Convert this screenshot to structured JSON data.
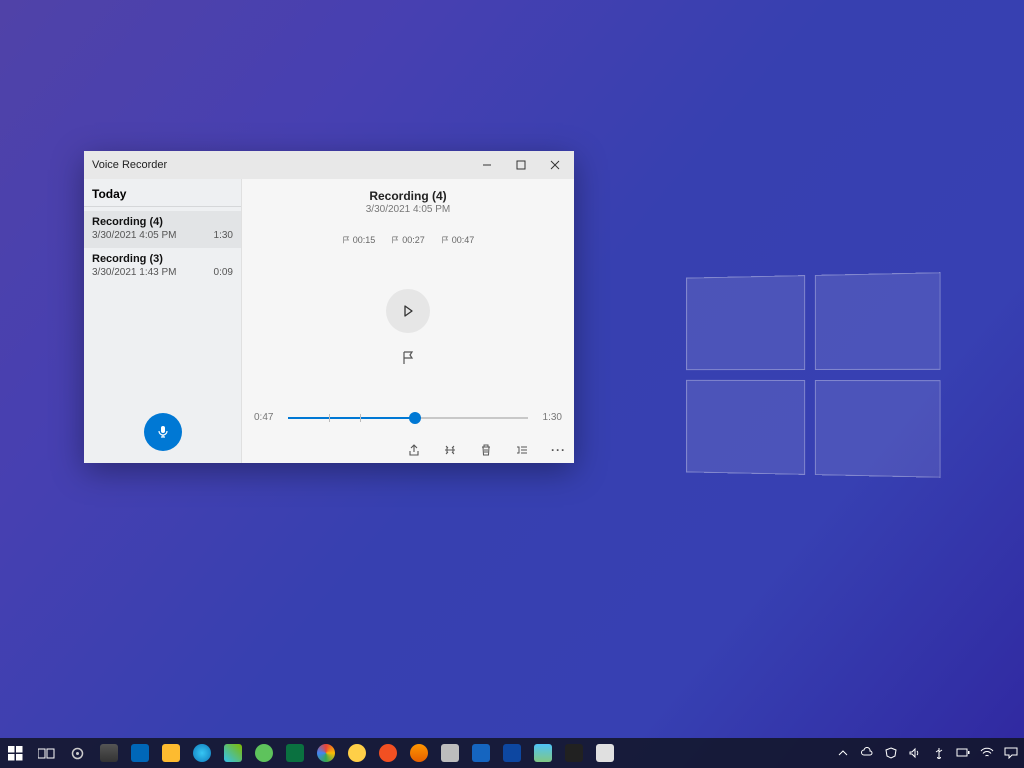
{
  "window": {
    "title": "Voice Recorder"
  },
  "sidebar": {
    "header": "Today",
    "recordings": [
      {
        "name": "Recording (4)",
        "date": "3/30/2021 4:05 PM",
        "duration": "1:30"
      },
      {
        "name": "Recording (3)",
        "date": "3/30/2021 1:43 PM",
        "duration": "0:09"
      }
    ]
  },
  "main": {
    "title": "Recording (4)",
    "date": "3/30/2021 4:05 PM",
    "markers": [
      "00:15",
      "00:27",
      "00:47"
    ],
    "current_time": "0:47",
    "total_time": "1:30"
  },
  "colors": {
    "accent": "#0078d4"
  }
}
